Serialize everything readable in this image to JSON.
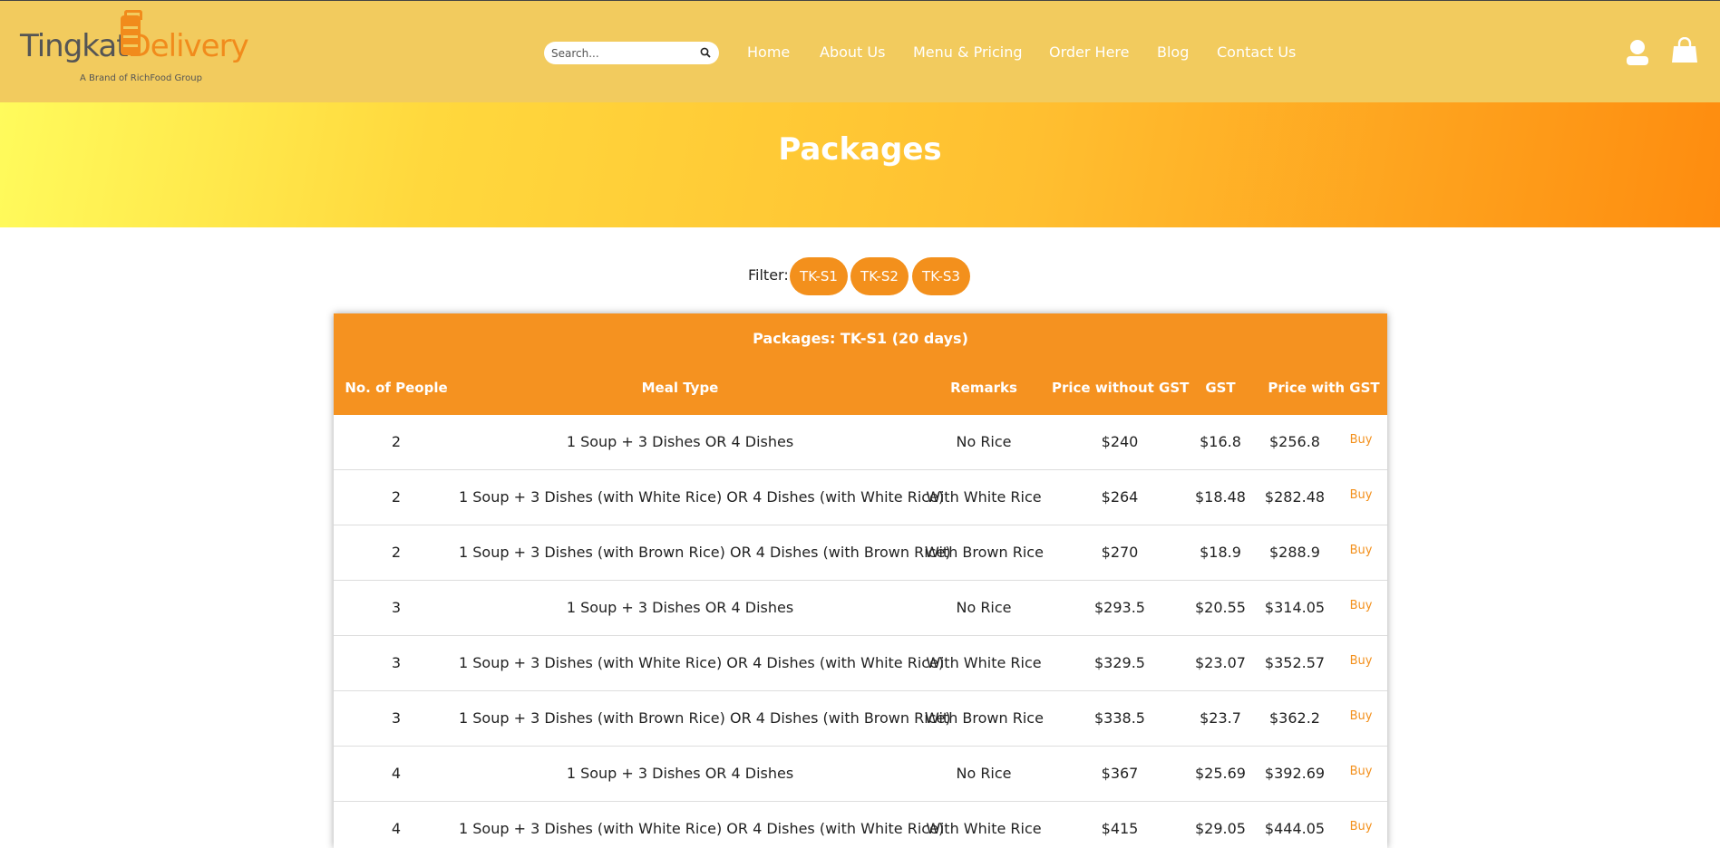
{
  "header": {
    "logo": {
      "part1": "Tingkat",
      "part2": "Delivery",
      "tagline": "A Brand of RichFood Group"
    },
    "search": {
      "placeholder": "Search..."
    },
    "nav": [
      "Home",
      "About Us",
      "Menu & Pricing",
      "Order Here",
      "Blog",
      "Contact Us"
    ]
  },
  "banner": {
    "title": "Packages"
  },
  "filter": {
    "label": "Filter:",
    "options": [
      "TK-S1",
      "TK-S2",
      "TK-S3"
    ]
  },
  "table": {
    "title": "Packages: TK-S1 (20 days)",
    "columns": [
      "No. of People",
      "Meal Type",
      "Remarks",
      "Price without GST",
      "GST",
      "Price with GST"
    ],
    "buy_label": "Buy",
    "rows": [
      [
        "2",
        "1 Soup + 3 Dishes OR 4 Dishes",
        "No Rice",
        "$240",
        "$16.8",
        "$256.8"
      ],
      [
        "2",
        "1 Soup + 3 Dishes (with White Rice) OR 4 Dishes (with White Rice)",
        "With White Rice",
        "$264",
        "$18.48",
        "$282.48"
      ],
      [
        "2",
        "1 Soup + 3 Dishes (with Brown Rice) OR 4 Dishes (with Brown Rice)",
        "With Brown Rice",
        "$270",
        "$18.9",
        "$288.9"
      ],
      [
        "3",
        "1 Soup + 3 Dishes OR 4 Dishes",
        "No Rice",
        "$293.5",
        "$20.55",
        "$314.05"
      ],
      [
        "3",
        "1 Soup + 3 Dishes (with White Rice) OR 4 Dishes (with White Rice)",
        "With White Rice",
        "$329.5",
        "$23.07",
        "$352.57"
      ],
      [
        "3",
        "1 Soup + 3 Dishes (with Brown Rice) OR 4 Dishes (with Brown Rice)",
        "With Brown Rice",
        "$338.5",
        "$23.7",
        "$362.2"
      ],
      [
        "4",
        "1 Soup + 3 Dishes OR 4 Dishes",
        "No Rice",
        "$367",
        "$25.69",
        "$392.69"
      ],
      [
        "4",
        "1 Soup + 3 Dishes (with White Rice) OR 4 Dishes (with White Rice)",
        "With White Rice",
        "$415",
        "$29.05",
        "$444.05"
      ]
    ]
  },
  "colors": {
    "header_bg": "#f2cb5e",
    "accent": "#f3901c",
    "banner_start": "#fffb5c",
    "banner_end": "#fe8c0f"
  }
}
